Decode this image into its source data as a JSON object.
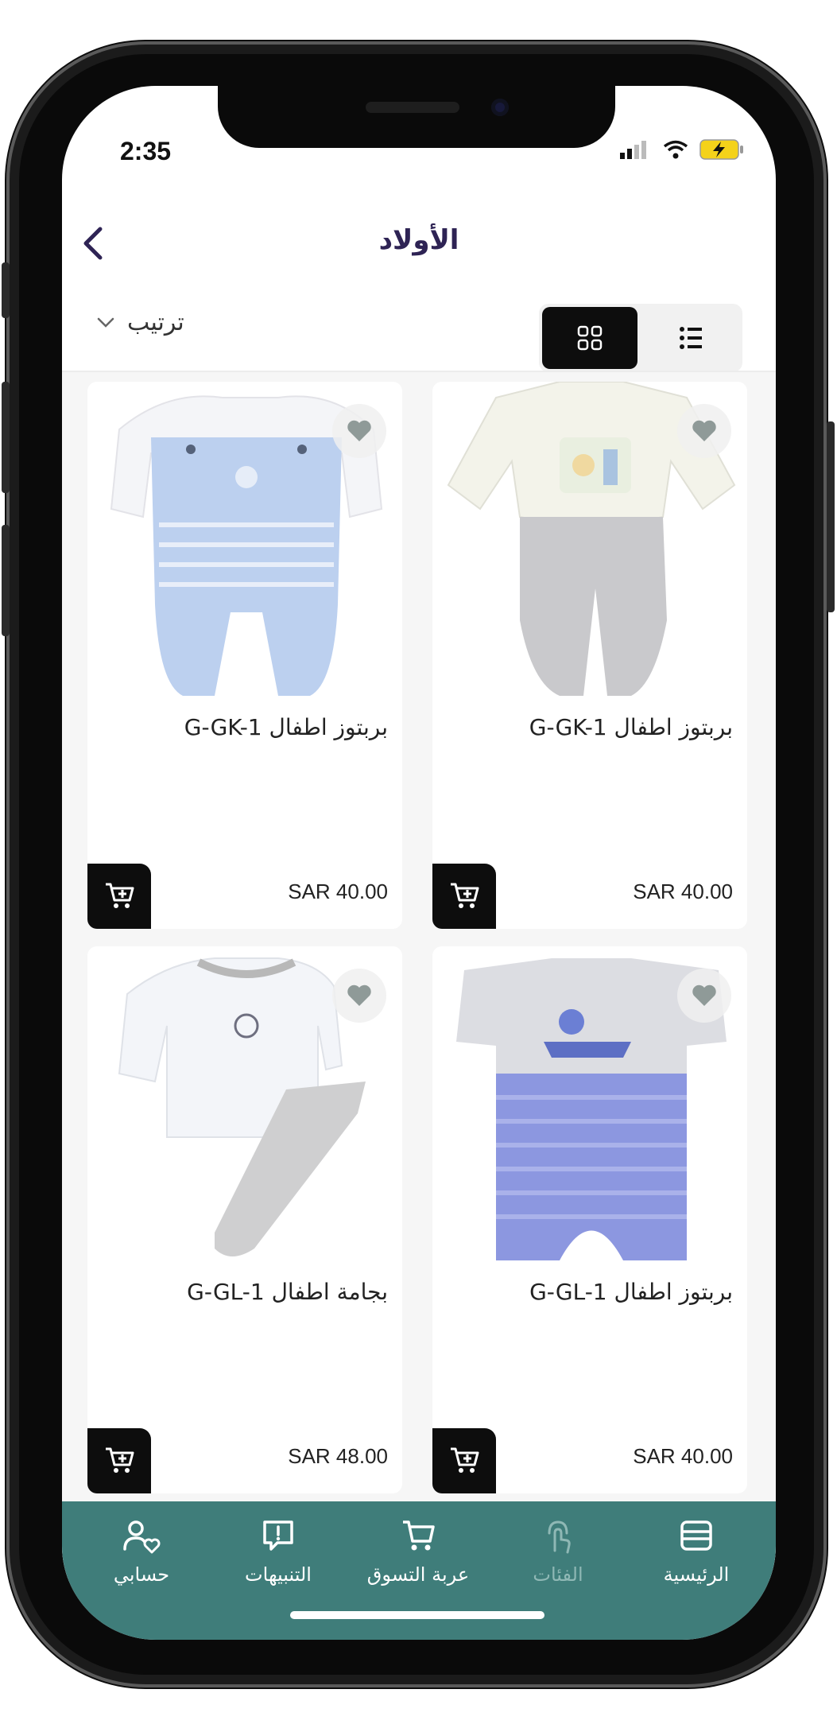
{
  "status_bar": {
    "time": "2:35"
  },
  "header": {
    "title": "الأولاد",
    "back_icon": "chevron-left-icon"
  },
  "toolbar": {
    "sort_label": "ترتيب",
    "grid_view_icon": "grid-icon",
    "list_view_icon": "list-icon"
  },
  "products": [
    {
      "name": "بربتوز اطفال G-GK-1",
      "price": "SAR 40.00"
    },
    {
      "name": "بربتوز اطفال G-GK-1",
      "price": "SAR 40.00"
    },
    {
      "name": "بربتوز اطفال G-GL-1",
      "price": "SAR 40.00"
    },
    {
      "name": "بجامة اطفال G-GL-1",
      "price": "SAR 48.00"
    }
  ],
  "tabbar": {
    "home": "الرئيسية",
    "categories": "الفئات",
    "cart": "عربة التسوق",
    "notifications": "التنبيهات",
    "account": "حسابي"
  },
  "colors": {
    "accent": "#2e2354",
    "tabbar": "#3f7d7a",
    "dark": "#0d0d0d"
  }
}
